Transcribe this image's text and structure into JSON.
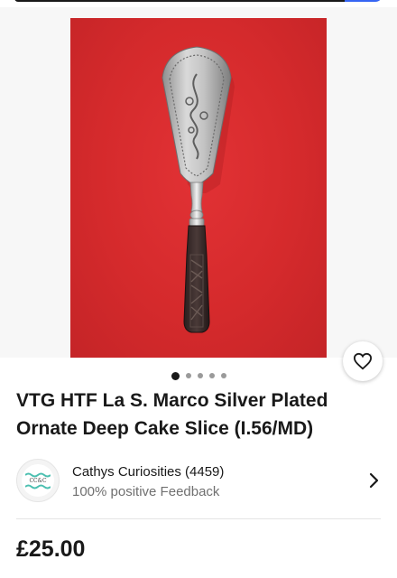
{
  "gallery": {
    "image_alt": "Ornate silver plated cake slice on red background",
    "favorite_icon": "heart-icon",
    "pager": {
      "total": 5,
      "active": 1
    }
  },
  "listing": {
    "title_line1": "VTG HTF La S. Marco Silver Plated",
    "title_line2": "Ornate Deep Cake Slice (I.56/MD)",
    "price": "£25.00"
  },
  "seller": {
    "name": "Cathys Curiosities (4459)",
    "feedback": "100% positive Feedback",
    "avatar_text": "CC&C",
    "chevron_icon": "chevron-right-icon"
  },
  "colors": {
    "accent": "#3665f3",
    "photo_background": "#d52a2c",
    "text_primary": "#191919",
    "text_secondary": "#707070"
  }
}
